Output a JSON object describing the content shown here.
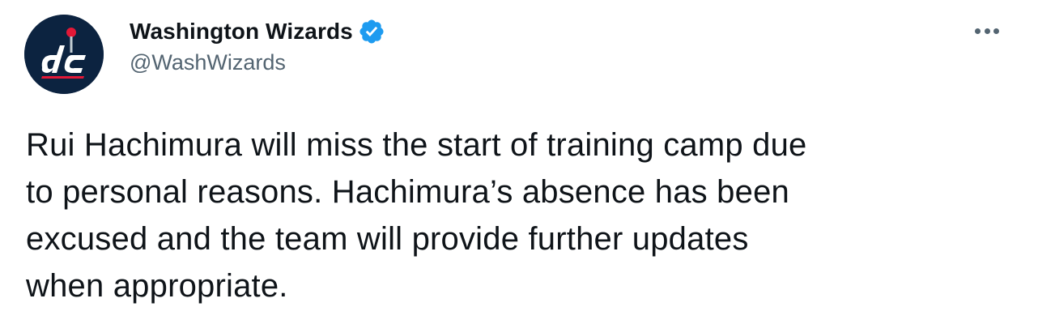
{
  "author": {
    "display_name": "Washington Wizards",
    "handle": "@WashWizards",
    "avatar_icon": "wizards-dc-logo-icon",
    "avatar_logo_text": "dc",
    "verified": true,
    "verified_icon": "verified-badge-icon"
  },
  "menu": {
    "more_icon": "more-horizontal-icon"
  },
  "tweet": {
    "text": "Rui Hachimura will miss the start of training camp due\nto personal reasons. Hachimura’s absence has been\nexcused and the team will provide further updates\nwhen appropriate."
  },
  "colors": {
    "text": "#0f1419",
    "secondary_text": "#536471",
    "verified_blue": "#1d9bf0",
    "avatar_navy": "#0c2340",
    "logo_red": "#e31837"
  }
}
